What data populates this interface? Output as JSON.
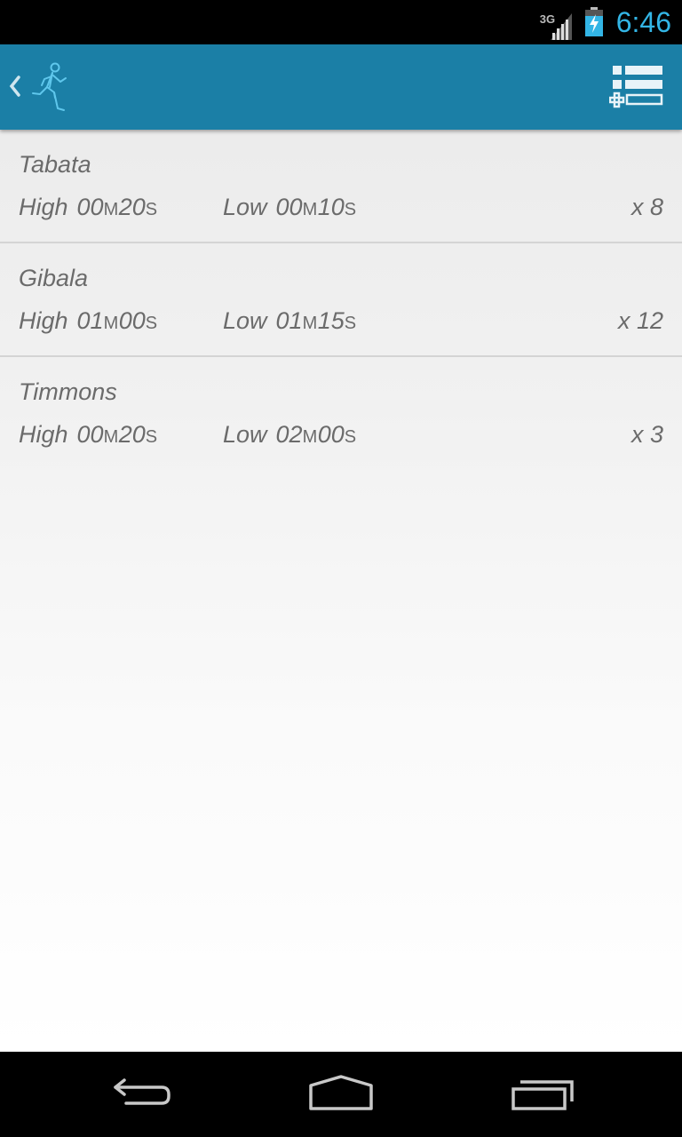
{
  "status_bar": {
    "network_type": "3G",
    "time": "6:46",
    "icons": [
      "signal-icon",
      "battery-charging-icon"
    ]
  },
  "action_bar": {
    "icons": [
      "up-caret-icon",
      "runner-app-icon",
      "add-list-icon"
    ]
  },
  "workouts": [
    {
      "name": "Tabata",
      "high_label": "High",
      "high_min": "00",
      "high_sec": "20",
      "low_label": "Low",
      "low_min": "00",
      "low_sec": "10",
      "reps": "x 8"
    },
    {
      "name": "Gibala",
      "high_label": "High",
      "high_min": "01",
      "high_sec": "00",
      "low_label": "Low",
      "low_min": "01",
      "low_sec": "15",
      "reps": "x 12"
    },
    {
      "name": "Timmons",
      "high_label": "High",
      "high_min": "00",
      "high_sec": "20",
      "low_label": "Low",
      "low_min": "02",
      "low_sec": "00",
      "reps": "x 3"
    }
  ],
  "units": {
    "minutes": "M",
    "seconds": "S"
  },
  "nav_bar": {
    "icons": [
      "back-icon",
      "home-icon",
      "recent-apps-icon"
    ]
  },
  "colors": {
    "action_bar": "#1b7fa6",
    "clock": "#33b5e5",
    "text": "#6b6b6b"
  }
}
